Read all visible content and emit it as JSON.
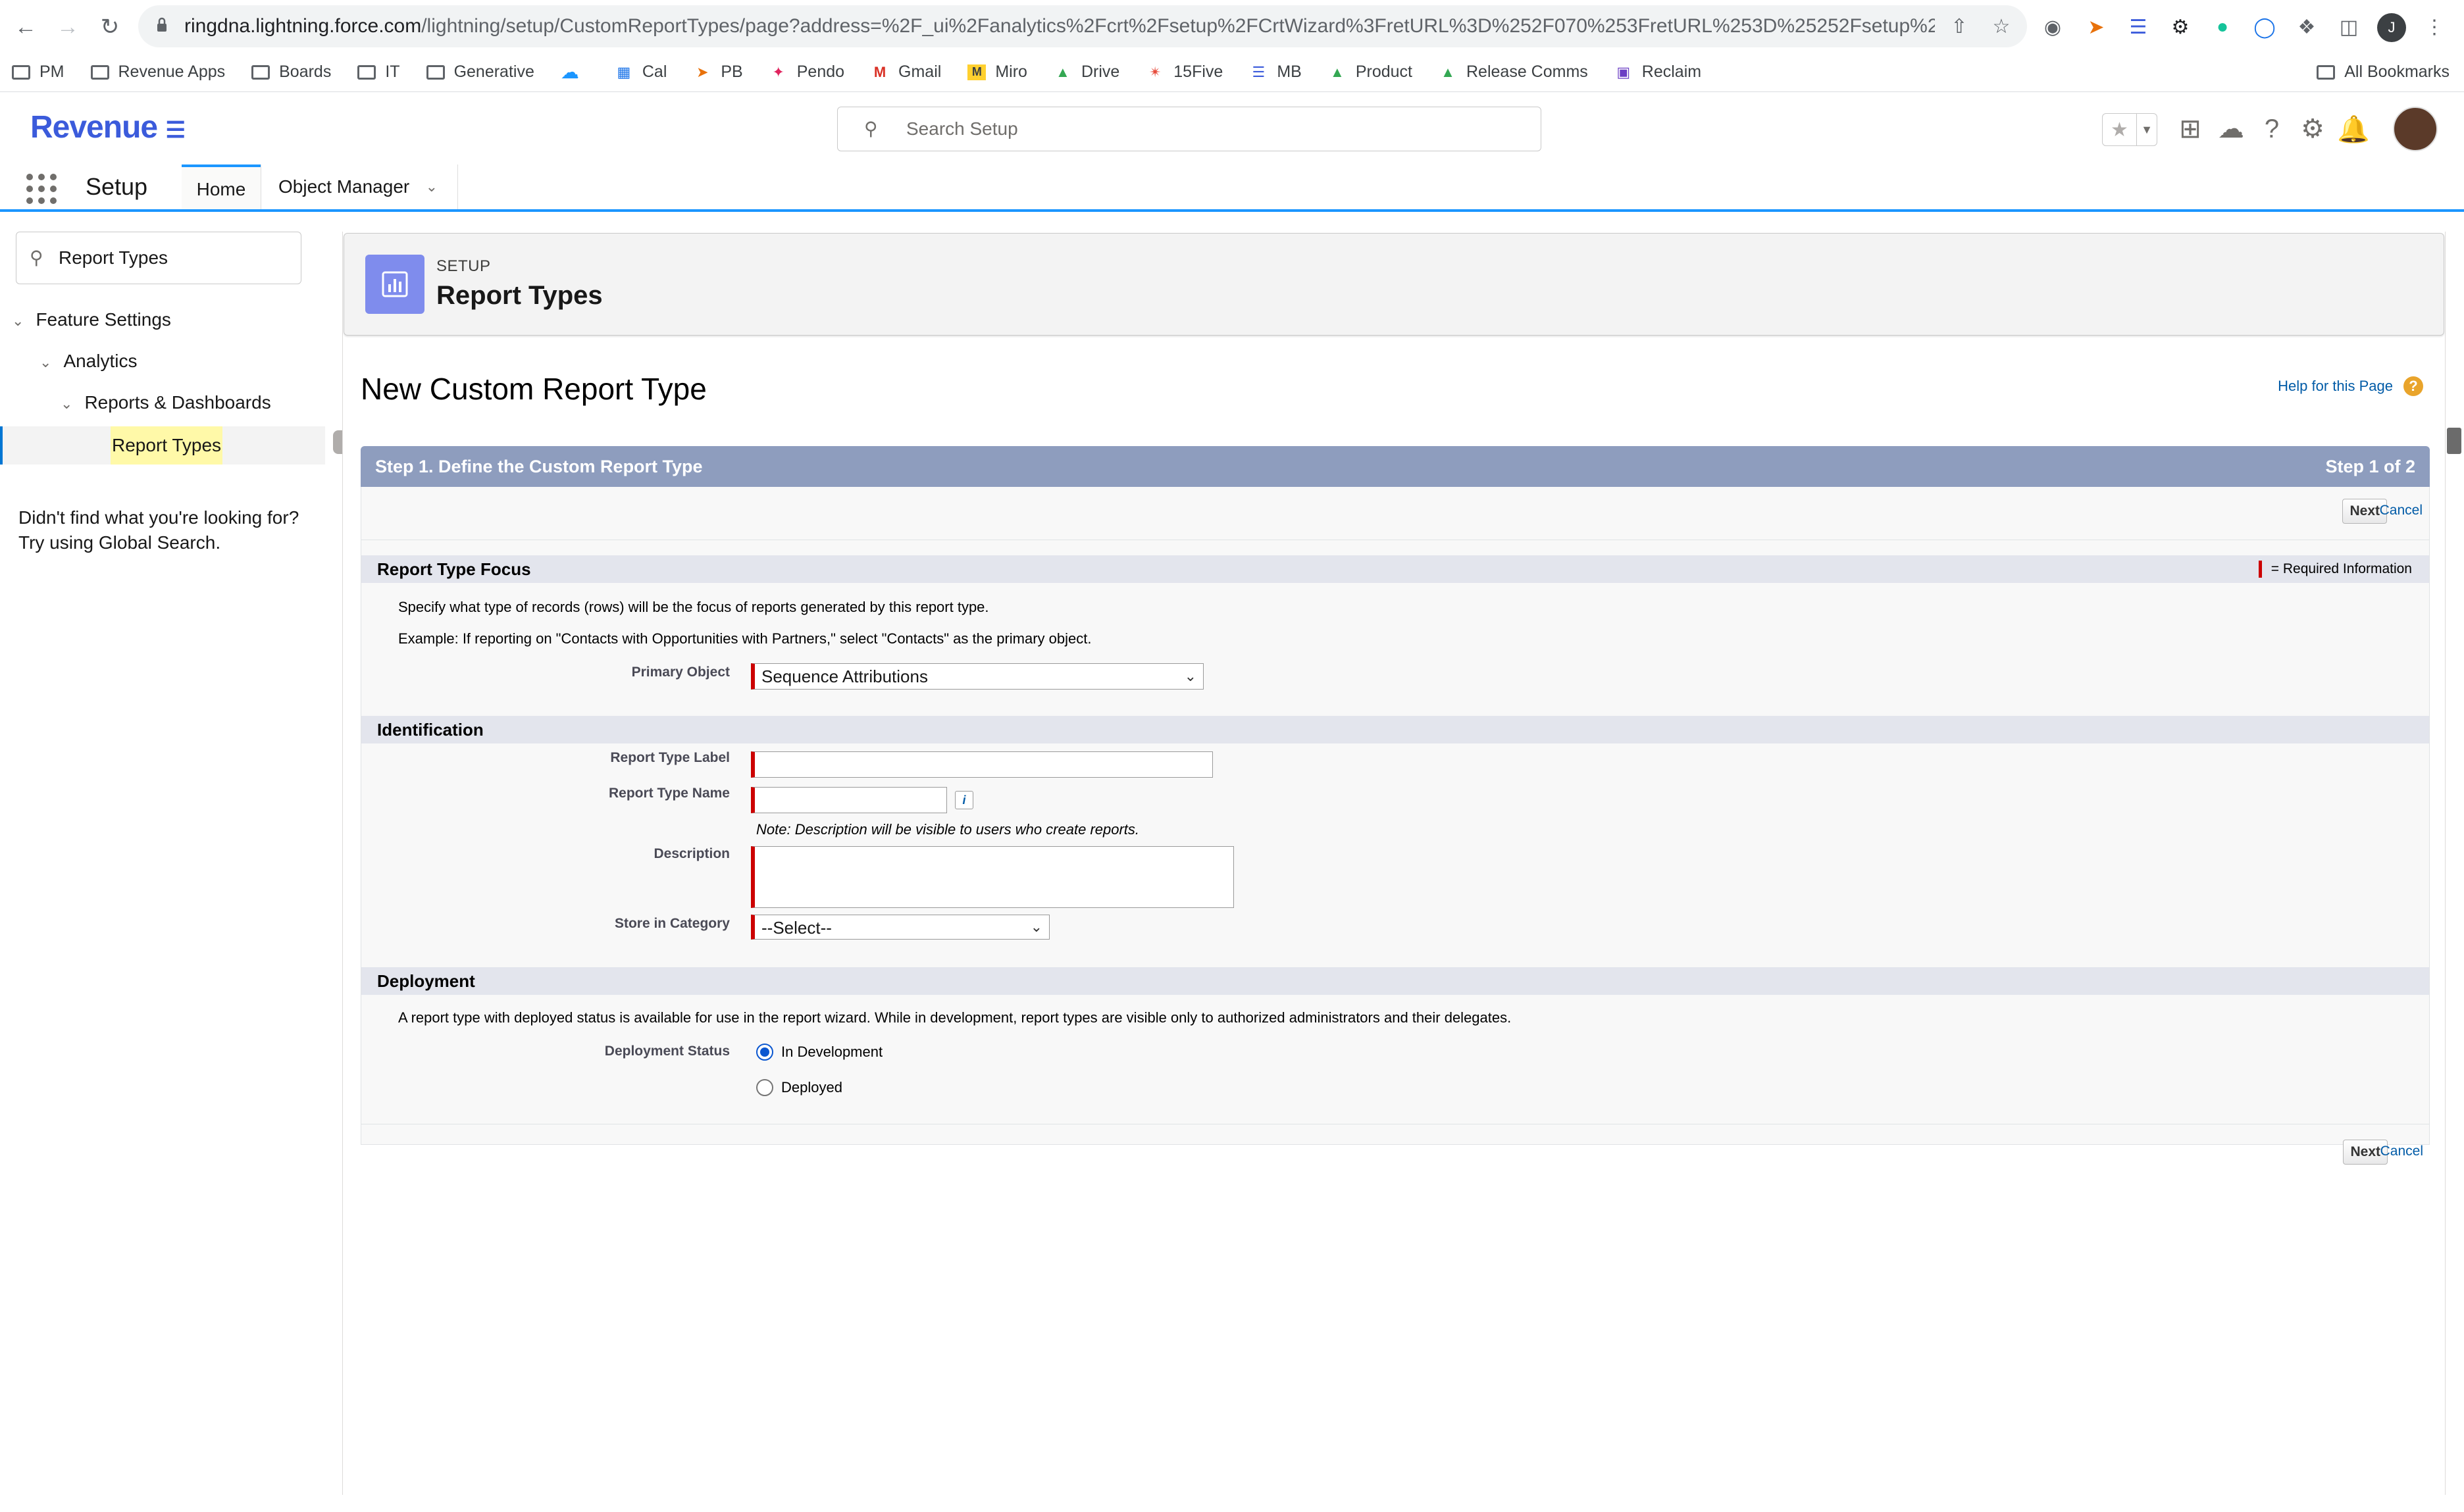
{
  "browser": {
    "url_host": "ringdna.lightning.force.com",
    "url_path": "/lightning/setup/CustomReportTypes/page?address=%2F_ui%2Fanalytics%2Fcrt%2Fsetup%2FCrtWizard%3FretURL%3D%252F070%253FretURL%253D%25252Fsetup%2...",
    "profile_initial": "J",
    "bookmarks": [
      {
        "label": "PM",
        "icon": "folder-icon"
      },
      {
        "label": "Revenue Apps",
        "icon": "folder-icon"
      },
      {
        "label": "Boards",
        "icon": "folder-icon"
      },
      {
        "label": "IT",
        "icon": "folder-icon"
      },
      {
        "label": "Generative",
        "icon": "folder-icon"
      },
      {
        "label": "",
        "icon": "salesforce-cloud-icon"
      },
      {
        "label": "Cal",
        "icon": "calendar-icon"
      },
      {
        "label": "PB",
        "icon": "pb-icon"
      },
      {
        "label": "Pendo",
        "icon": "pendo-icon"
      },
      {
        "label": "Gmail",
        "icon": "gmail-icon"
      },
      {
        "label": "Miro",
        "icon": "miro-icon"
      },
      {
        "label": "Drive",
        "icon": "drive-icon"
      },
      {
        "label": "15Five",
        "icon": "fifteen-five-icon"
      },
      {
        "label": "MB",
        "icon": "mb-icon"
      },
      {
        "label": "Product",
        "icon": "drive-icon"
      },
      {
        "label": "Release Comms",
        "icon": "drive-icon"
      },
      {
        "label": "Reclaim",
        "icon": "reclaim-icon"
      }
    ],
    "all_bookmarks": "All Bookmarks"
  },
  "header": {
    "logo": "Revenue",
    "search_placeholder": "Search Setup"
  },
  "nav": {
    "app_name": "Setup",
    "tabs": [
      {
        "label": "Home"
      },
      {
        "label": "Object Manager"
      }
    ]
  },
  "sidebar": {
    "search_value": "Report Types",
    "tree": [
      {
        "label": "Feature Settings"
      },
      {
        "label": "Analytics"
      },
      {
        "label": "Reports & Dashboards"
      },
      {
        "label": "Report Types"
      }
    ],
    "not_found_line1": "Didn't find what you're looking for?",
    "not_found_line2": "Try using Global Search."
  },
  "page_header": {
    "eyebrow": "SETUP",
    "title": "Report Types"
  },
  "wizard": {
    "title": "New Custom Report Type",
    "help_link": "Help for this Page",
    "step_title": "Step 1. Define the Custom Report Type",
    "step_count": "Step 1 of 2",
    "next_label": "Next",
    "cancel_label": "Cancel",
    "required_legend": "= Required Information",
    "sections": {
      "focus": {
        "title": "Report Type Focus",
        "desc1": "Specify what type of records (rows) will be the focus of reports generated by this report type.",
        "desc2": "Example: If reporting on \"Contacts with Opportunities with Partners,\" select \"Contacts\" as the primary object.",
        "primary_object_label": "Primary Object",
        "primary_object_value": "Sequence Attributions"
      },
      "identification": {
        "title": "Identification",
        "label_label": "Report Type Label",
        "label_value": "",
        "name_label": "Report Type Name",
        "name_value": "",
        "note": "Note: Description will be visible to users who create reports.",
        "description_label": "Description",
        "description_value": "",
        "category_label": "Store in Category",
        "category_value": "--Select--"
      },
      "deployment": {
        "title": "Deployment",
        "desc": "A report type with deployed status is available for use in the report wizard. While in development, report types are visible only to authorized administrators and their delegates.",
        "status_label": "Deployment Status",
        "options": [
          "In Development",
          "Deployed"
        ],
        "selected": "In Development"
      }
    }
  },
  "colors": {
    "brand": "#3b5bdb",
    "step_bar": "#8e9dbe",
    "required": "#cc0000",
    "link": "#015ba7"
  }
}
